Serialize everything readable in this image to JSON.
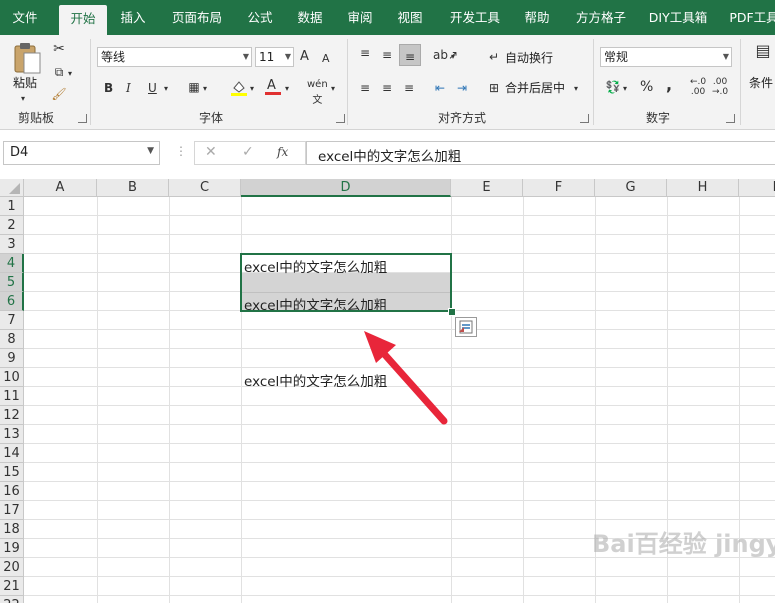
{
  "tabs": [
    "文件",
    "开始",
    "插入",
    "页面布局",
    "公式",
    "数据",
    "审阅",
    "视图",
    "开发工具",
    "帮助",
    "方方格子",
    "DIY工具箱",
    "PDF工具"
  ],
  "active_tab": "开始",
  "clipboard": {
    "paste_label": "粘贴",
    "group_label": "剪贴板"
  },
  "font": {
    "name": "等线",
    "size": "11",
    "group_label": "字体",
    "bold": "B",
    "italic": "I",
    "underline": "U",
    "increase": "A",
    "decrease": "A"
  },
  "alignment": {
    "wrap_label": "自动换行",
    "merge_label": "合并后居中",
    "group_label": "对齐方式"
  },
  "number": {
    "format": "常规",
    "group_label": "数字",
    "percent": "%",
    "comma": ","
  },
  "styles": {
    "conditional_label": "条件"
  },
  "formula_bar": {
    "name_box": "D4",
    "fx": "fx",
    "formula": "excel中的文字怎么加粗"
  },
  "columns": [
    "A",
    "B",
    "C",
    "D",
    "E",
    "F",
    "G",
    "H",
    "I"
  ],
  "rows": [
    "1",
    "2",
    "3",
    "4",
    "5",
    "6",
    "7",
    "8",
    "9",
    "10",
    "11",
    "12",
    "13",
    "14",
    "15",
    "16",
    "17",
    "18",
    "19",
    "20",
    "21",
    "22"
  ],
  "selected_column": "D",
  "cells": {
    "d4": "excel中的文字怎么加粗",
    "d6": "excel中的文字怎么加粗",
    "d10": "excel中的文字怎么加粗"
  },
  "colors": {
    "accent": "#217346",
    "selection_fill": "#d4d4d4",
    "arrow": "#e8263a"
  },
  "watermark": "Bai百经验 jingyan.baidu.com"
}
